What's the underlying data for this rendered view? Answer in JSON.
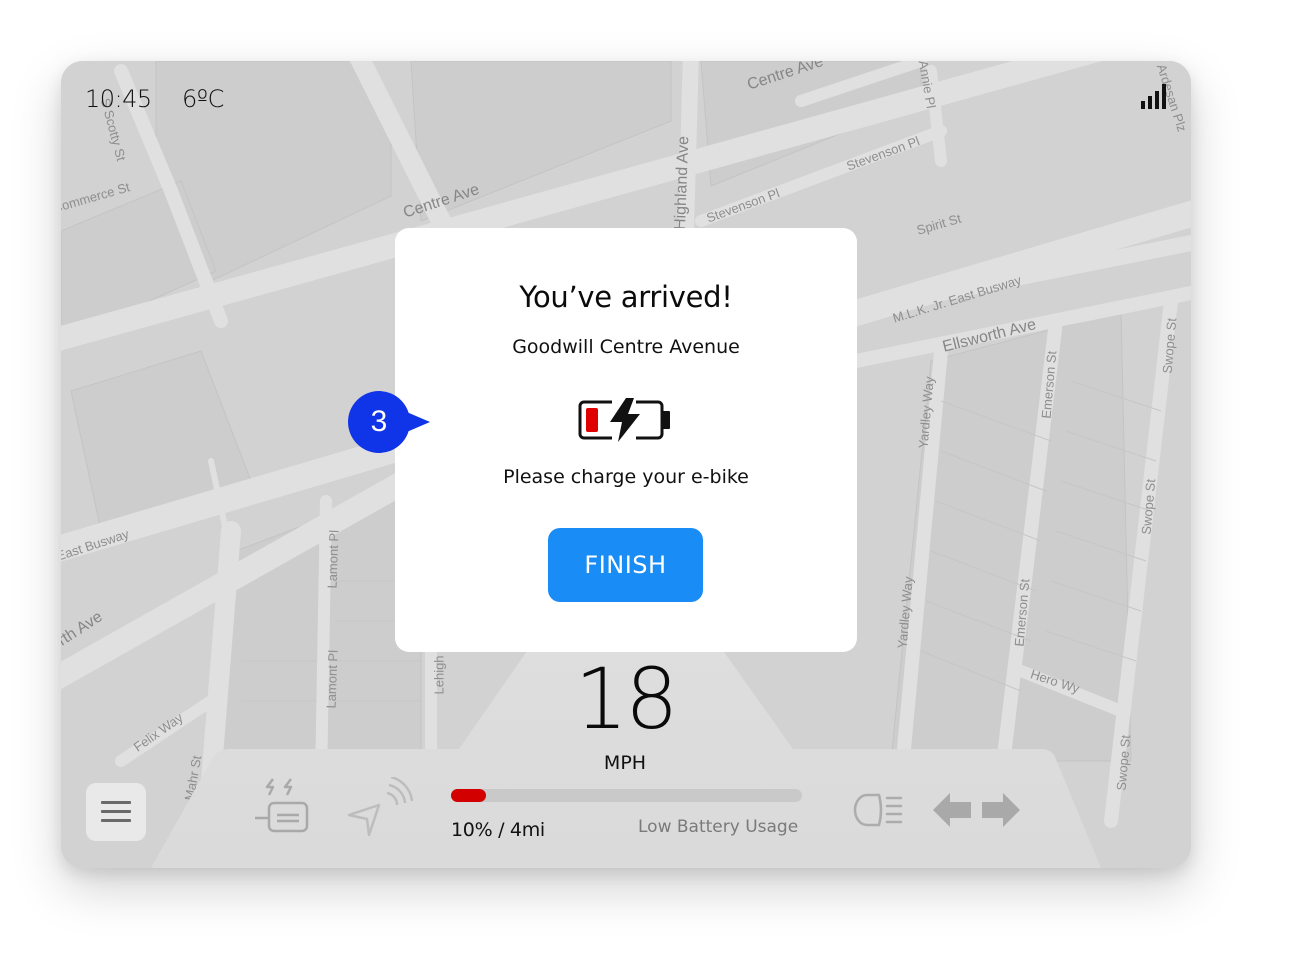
{
  "status_bar": {
    "time": "10:45",
    "temperature": "6ºC",
    "signal_icon": "signal-strength-icon",
    "signal_bars": 4
  },
  "map": {
    "street_labels": [
      "S Scotty St",
      "Commerce St",
      "Centre Ave",
      "Centre Ave",
      "Highland Ave",
      "Stevenson Pl",
      "Stevenson Pl",
      "Spirit St",
      "M.L.K. Jr. East Busway",
      "Ellsworth Ave",
      "Yardley Way",
      "Yardley Way",
      "Emerson St",
      "Emerson St",
      "Swope St",
      "Swope St",
      "Swope St",
      "Hero Wy",
      "Lamont Pl",
      "Lamont Pl",
      "Lehigh",
      "East Busway",
      "Ellsworth Ave",
      "Felix Way",
      "Mahr St",
      "Annie Pl",
      "Ardesan Plz"
    ]
  },
  "modal": {
    "title": "You’ve arrived!",
    "destination": "Goodwill Centre Avenue",
    "battery_icon": "low-battery-charging-icon",
    "message": "Please charge your e-bike",
    "finish_label": "FINISH",
    "colors": {
      "button": "#1a8cf5",
      "battery_low": "#d30000"
    }
  },
  "step_badge": {
    "number": "3",
    "color": "#1034e8"
  },
  "dashboard": {
    "speed": "18",
    "speed_unit": "MPH",
    "battery_percent": 10,
    "battery_readout": "10% / 4mi",
    "battery_status": "Low Battery Usage",
    "battery_fill_color": "#d30000",
    "icons": {
      "menu": "menu-icon",
      "charging": "battery-charging-icon",
      "navigation": "navigation-signal-icon",
      "headlight": "headlight-icon",
      "turn_left": "turn-left-arrow-icon",
      "turn_right": "turn-right-arrow-icon"
    }
  }
}
